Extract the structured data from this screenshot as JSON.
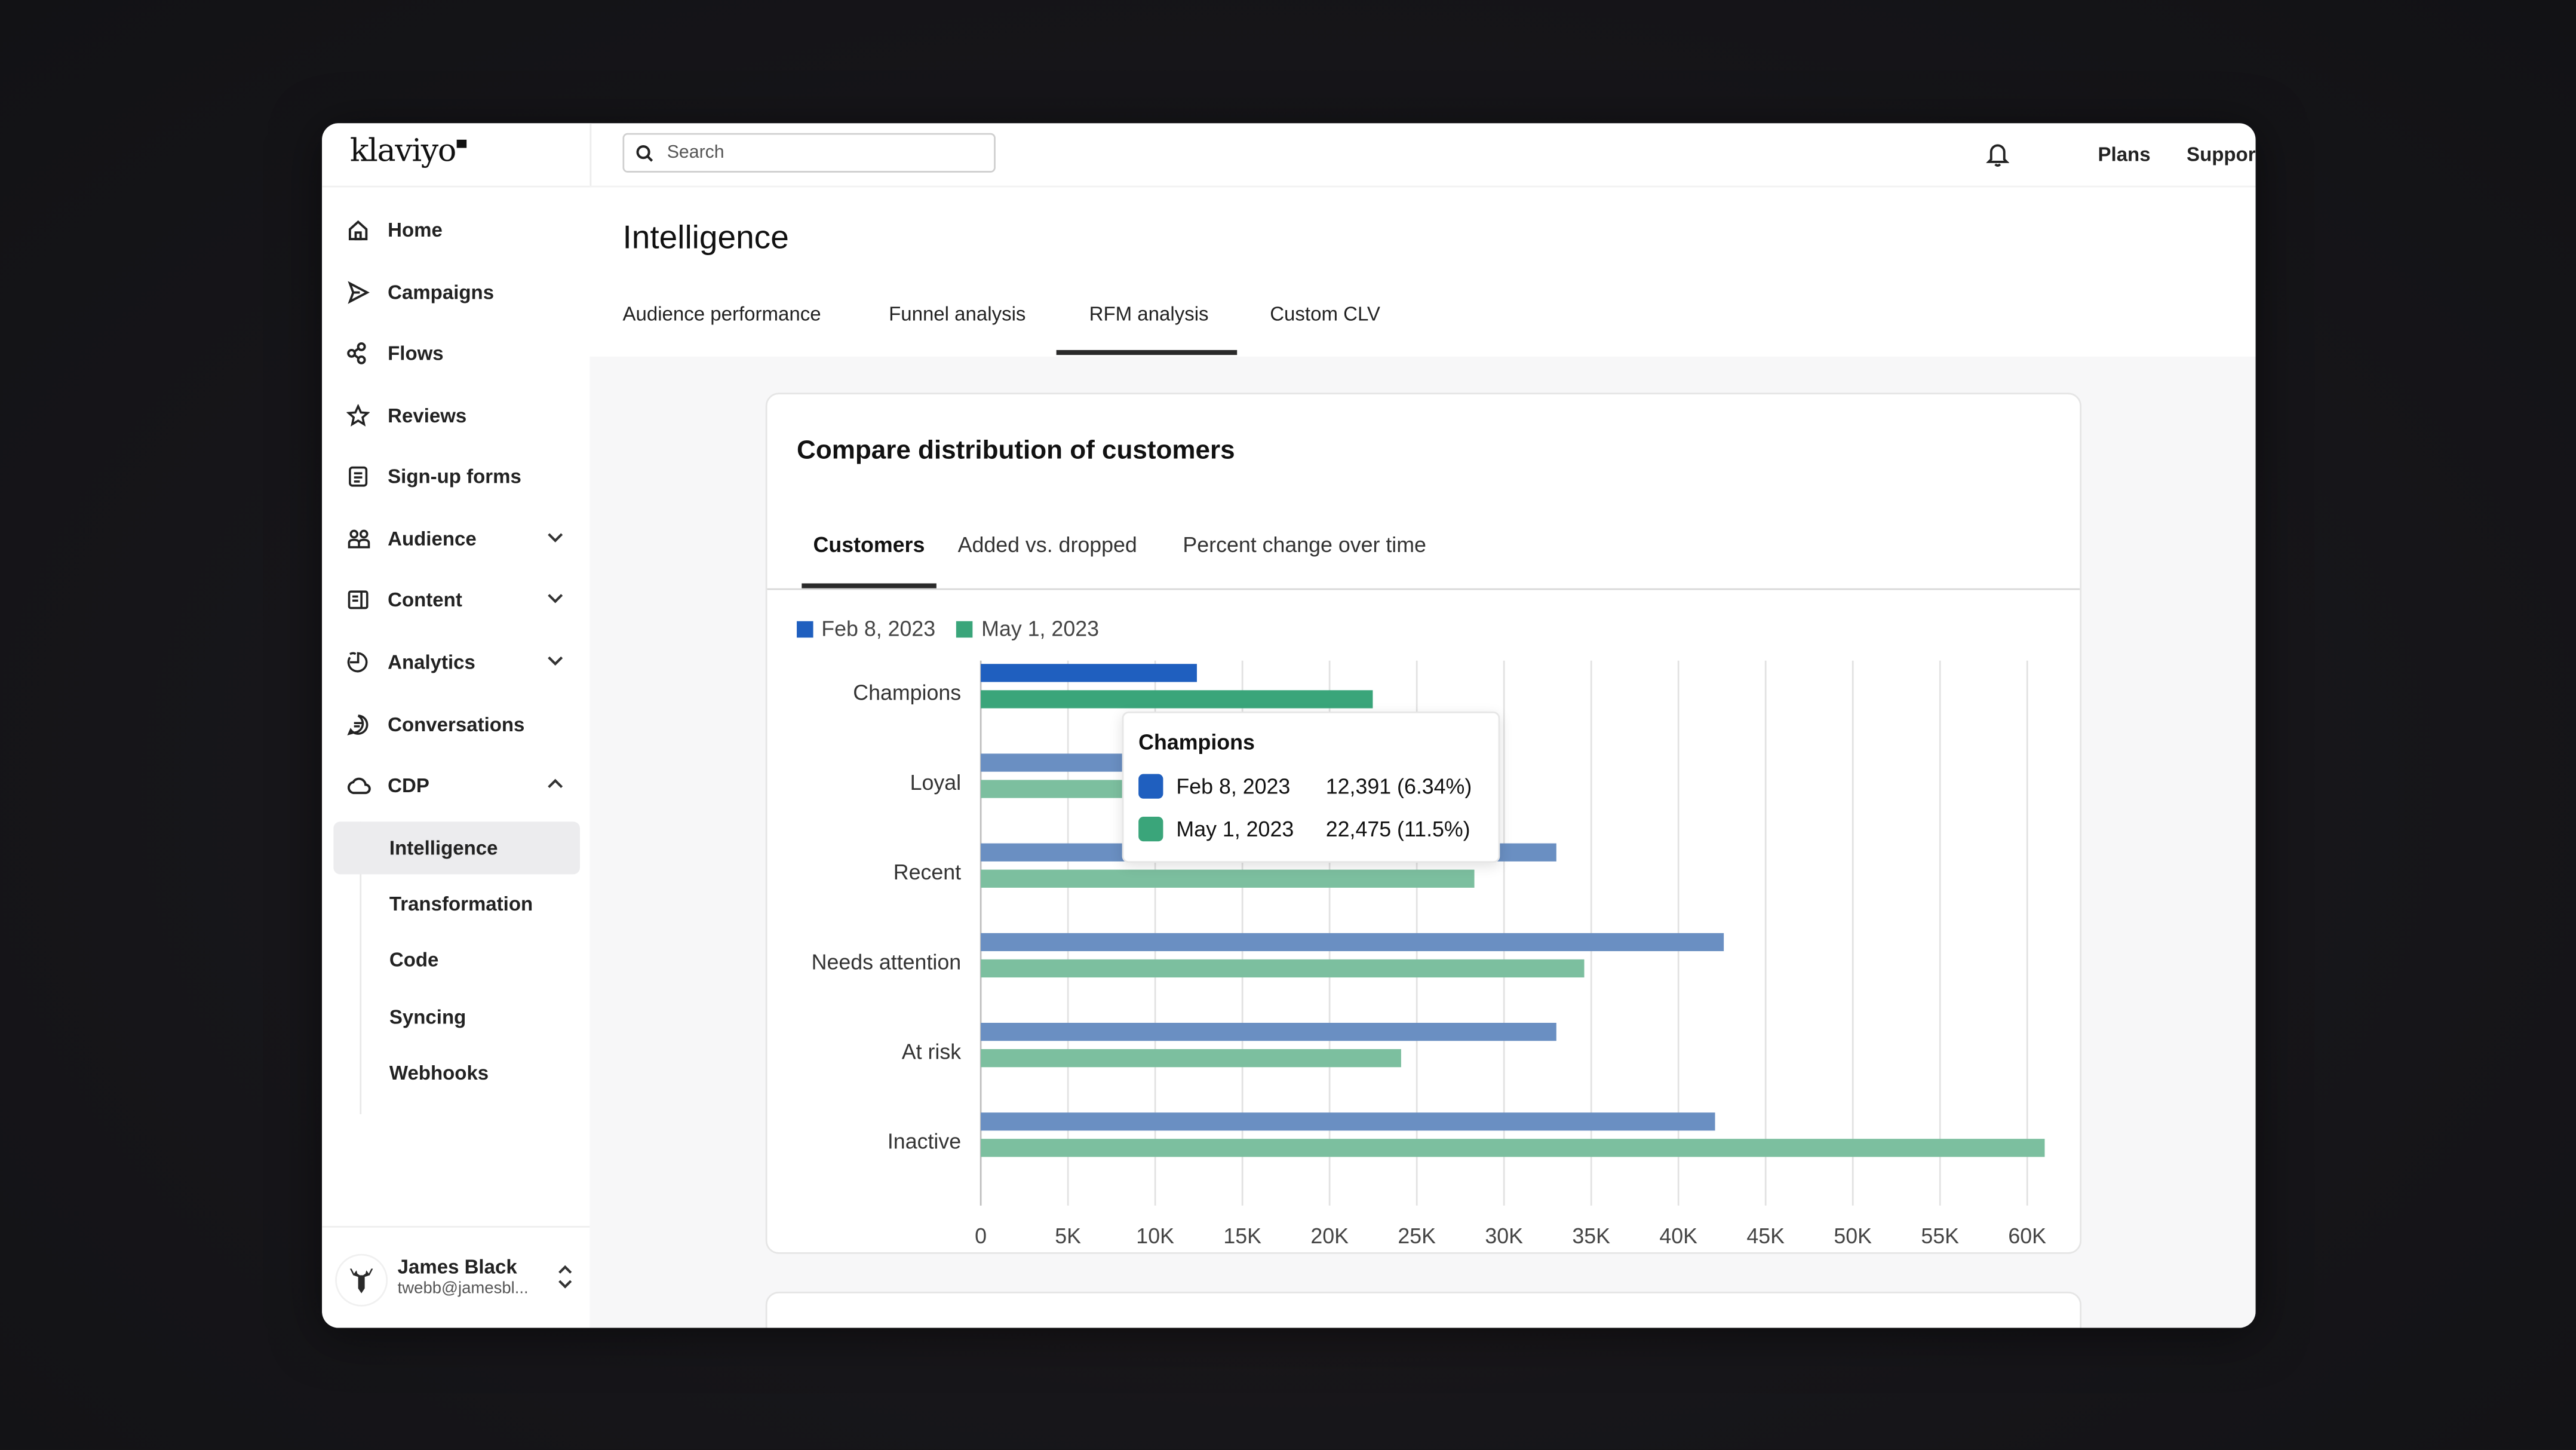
{
  "app": {
    "logo": "klaviyo"
  },
  "topbar": {
    "search_placeholder": "Search",
    "links": [
      "Plans",
      "Support"
    ]
  },
  "sidebar": {
    "items": [
      {
        "label": "Home",
        "icon": "home-icon"
      },
      {
        "label": "Campaigns",
        "icon": "send-icon"
      },
      {
        "label": "Flows",
        "icon": "flows-icon"
      },
      {
        "label": "Reviews",
        "icon": "star-icon"
      },
      {
        "label": "Sign-up forms",
        "icon": "form-icon"
      },
      {
        "label": "Audience",
        "icon": "people-icon",
        "chevron": "down"
      },
      {
        "label": "Content",
        "icon": "content-icon",
        "chevron": "down"
      },
      {
        "label": "Analytics",
        "icon": "analytics-icon",
        "chevron": "down"
      },
      {
        "label": "Conversations",
        "icon": "chat-icon"
      },
      {
        "label": "CDP",
        "icon": "cloud-icon",
        "chevron": "up"
      }
    ],
    "cdp_subitems": [
      {
        "label": "Intelligence",
        "active": true
      },
      {
        "label": "Transformation"
      },
      {
        "label": "Code"
      },
      {
        "label": "Syncing"
      },
      {
        "label": "Webhooks"
      }
    ],
    "user": {
      "name": "James Black",
      "email": "twebb@jamesbl..."
    }
  },
  "page": {
    "title": "Intelligence",
    "tabs": [
      "Audience performance",
      "Funnel analysis",
      "RFM analysis",
      "Custom CLV"
    ],
    "active_tab": "RFM analysis"
  },
  "card": {
    "title": "Compare distribution of customers",
    "tabs": [
      "Customers",
      "Added vs. dropped",
      "Percent change over time"
    ],
    "active_tab": "Customers"
  },
  "tooltip": {
    "title": "Champions",
    "rows": [
      {
        "date": "Feb 8, 2023",
        "value": "12,391 (6.34%)",
        "color": "#1f5fbf"
      },
      {
        "date": "May 1, 2023",
        "value": "22,475 (11.5%)",
        "color": "#3aa57a"
      }
    ]
  },
  "chart_data": {
    "type": "bar",
    "orientation": "horizontal",
    "title": "Compare distribution of customers",
    "xlabel": "",
    "ylabel": "",
    "categories": [
      "Champions",
      "Loyal",
      "Recent",
      "Needs attention",
      "At risk",
      "Inactive"
    ],
    "series": [
      {
        "name": "Feb 8, 2023",
        "color": "#6a8fc2",
        "highlight_color": "#1f5fbf",
        "values": [
          12391,
          15000,
          33000,
          42600,
          33000,
          42100
        ]
      },
      {
        "name": "May 1, 2023",
        "color": "#7cbf9f",
        "highlight_color": "#3aa57a",
        "values": [
          22475,
          16000,
          28300,
          34600,
          24100,
          61000
        ]
      }
    ],
    "highlighted_category": "Champions",
    "xlim": [
      0,
      60000
    ],
    "xticks": [
      0,
      5000,
      10000,
      15000,
      20000,
      25000,
      30000,
      35000,
      40000,
      45000,
      50000,
      55000,
      60000
    ],
    "xtick_labels": [
      "0",
      "5K",
      "10K",
      "15K",
      "20K",
      "25K",
      "30K",
      "35K",
      "40K",
      "45K",
      "50K",
      "55K",
      "60K"
    ],
    "grid": true,
    "legend": "top-left",
    "notes": "Loyal values obscured by tooltip; estimated."
  }
}
